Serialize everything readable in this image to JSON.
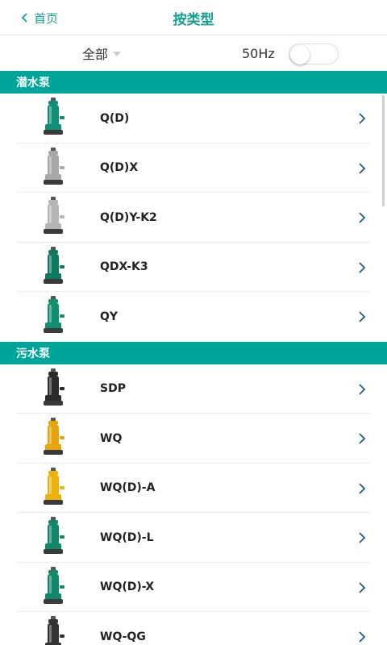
{
  "header": {
    "back_label": "首页",
    "title": "按类型"
  },
  "filter": {
    "category_selected": "全部",
    "frequency_label": "50Hz",
    "frequency_toggle_on": false
  },
  "colors": {
    "accent": "#00a59a",
    "text": "#222222"
  },
  "sections": [
    {
      "title": "潜水泵",
      "items": [
        {
          "name": "Q(D)",
          "pump_color": "#0f8f76"
        },
        {
          "name": "Q(D)X",
          "pump_color": "#a8a8a8"
        },
        {
          "name": "Q(D)Y-K2",
          "pump_color": "#b5b5b5"
        },
        {
          "name": "QDX-K3",
          "pump_color": "#0d7a5f"
        },
        {
          "name": "QY",
          "pump_color": "#108e6e"
        }
      ]
    },
    {
      "title": "污水泵",
      "items": [
        {
          "name": "SDP",
          "pump_color": "#2b2b2b"
        },
        {
          "name": "WQ",
          "pump_color": "#e6a40f"
        },
        {
          "name": "WQ(D)-A",
          "pump_color": "#ebb20e"
        },
        {
          "name": "WQ(D)-L",
          "pump_color": "#12876a"
        },
        {
          "name": "WQ(D)-X",
          "pump_color": "#12876a"
        },
        {
          "name": "WQ-QG",
          "pump_color": "#333333"
        }
      ]
    }
  ]
}
